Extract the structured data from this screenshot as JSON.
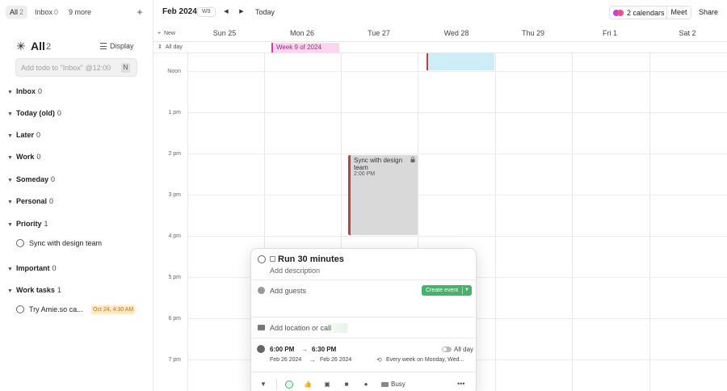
{
  "sidebar": {
    "tabs": [
      {
        "label": "All",
        "count": "2"
      },
      {
        "label": "Inbox",
        "count": "0"
      },
      {
        "label": "9 more",
        "count": ""
      }
    ],
    "add_icon": "plus-icon",
    "header": {
      "title": "All",
      "count": "2",
      "display_label": "Display"
    },
    "input_placeholder": "Add todo to \"Inbox\" @12:00",
    "input_shortcut": "N",
    "groups": [
      {
        "name": "Inbox",
        "count": "0"
      },
      {
        "name": "Today (old)",
        "count": "0"
      },
      {
        "name": "Later",
        "count": "0"
      },
      {
        "name": "Work",
        "count": "0"
      },
      {
        "name": "Someday",
        "count": "0"
      },
      {
        "name": "Personal",
        "count": "0"
      },
      {
        "name": "Priority",
        "count": "1"
      },
      {
        "name": "Important",
        "count": "0"
      },
      {
        "name": "Work tasks",
        "count": "1"
      }
    ],
    "tasks": [
      {
        "name": "Sync with design team",
        "badge": ""
      },
      {
        "name": "Try Amie.so ca...",
        "badge": "Oct 24, 4:30 AM"
      }
    ]
  },
  "topbar": {
    "month": "Feb 2024",
    "week_badge": "W9",
    "today_label": "Today",
    "calendars_label": "2 calendars",
    "meet_label": "Meet",
    "share_label": "Share"
  },
  "days": [
    {
      "name": "Sun",
      "date": "25"
    },
    {
      "name": "Mon",
      "date": "26"
    },
    {
      "name": "Tue",
      "date": "27"
    },
    {
      "name": "Wed",
      "date": "28"
    },
    {
      "name": "Thu",
      "date": "29"
    },
    {
      "name": "Fri",
      "date": "1"
    },
    {
      "name": "Sat",
      "date": "2"
    }
  ],
  "new_label": "New",
  "allday_label": "All day",
  "allday_event": "Week 9 of 2024",
  "time_labels": [
    "Noon",
    "1 pm",
    "2 pm",
    "3 pm",
    "4 pm",
    "5 pm",
    "6 pm",
    "7 pm"
  ],
  "events": {
    "sync": {
      "title": "Sync with design team",
      "time": "2:00 PM"
    }
  },
  "popup": {
    "title": "Run 30 minutes",
    "description_placeholder": "Add description",
    "guests_placeholder": "Add guests",
    "create_label": "Create event",
    "location_placeholder": "Add location or call",
    "start_time": "6:00 PM",
    "end_time": "6:30 PM",
    "allday_label": "All day",
    "start_date": "Feb 26 2024",
    "end_date": "Feb 26 2024",
    "repeat": "Every week on Monday, Wed...",
    "busy_label": "Busy"
  },
  "colors": {
    "accent_green": "#46b26c",
    "event_red": "#c83b3b",
    "allday_pink": "#d53ca4",
    "badge_orange": "#c87010"
  }
}
